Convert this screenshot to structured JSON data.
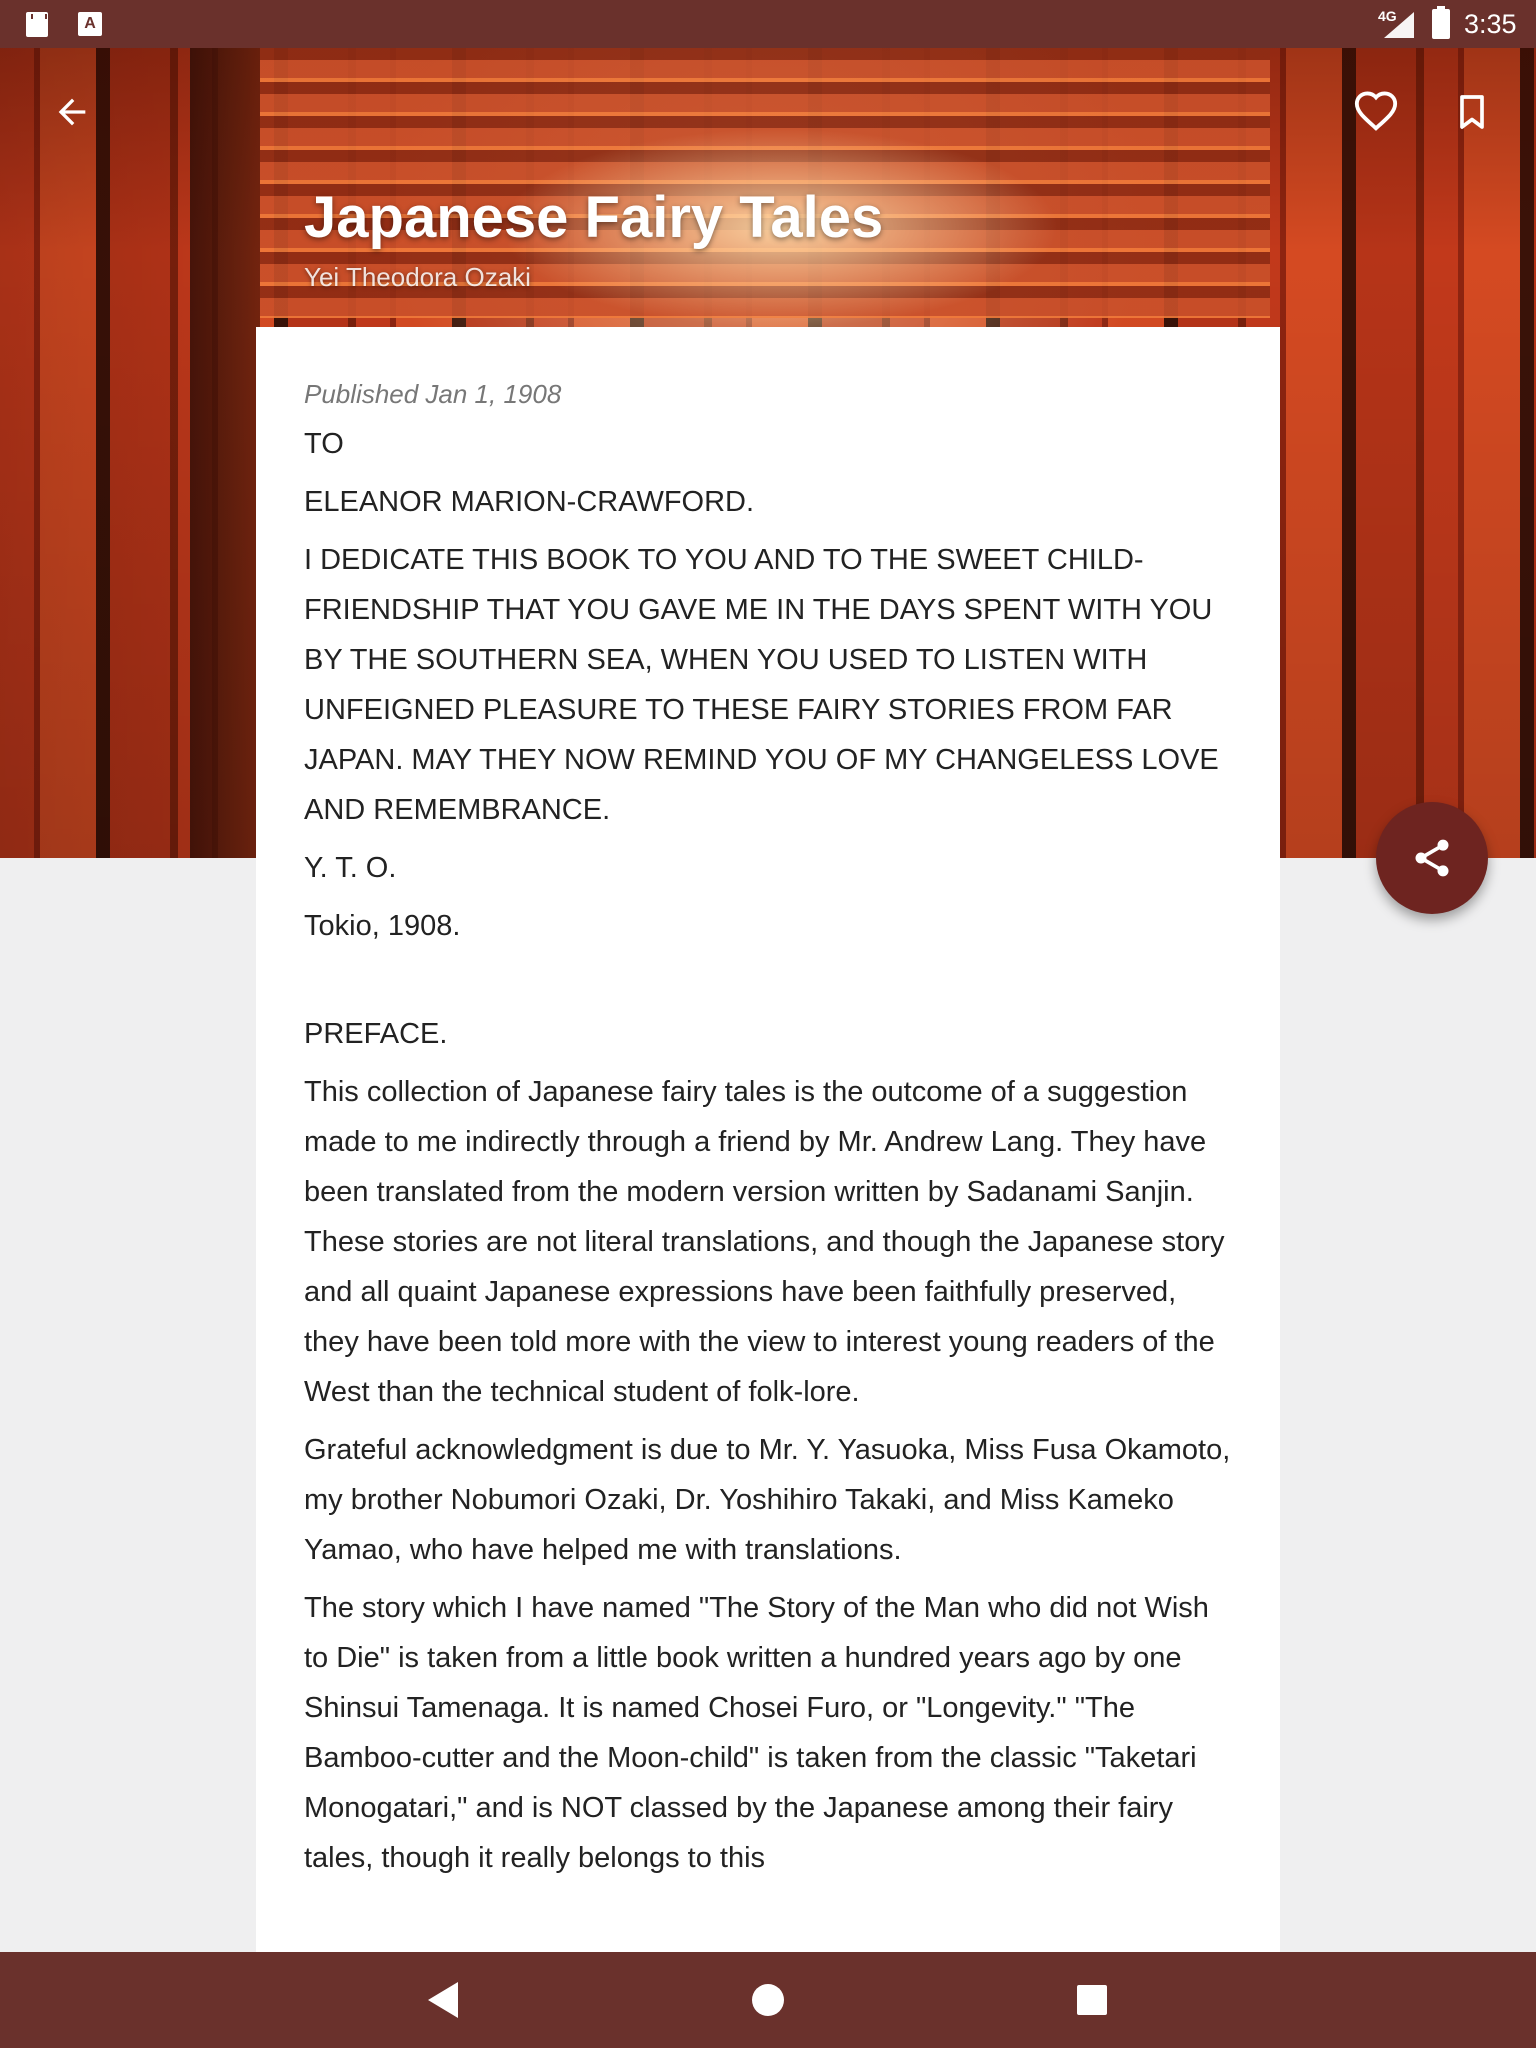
{
  "status_bar": {
    "network": "4G",
    "time": "3:35"
  },
  "header": {
    "title": "Japanese Fairy Tales",
    "author": "Yei Theodora Ozaki"
  },
  "icons": {
    "back": "arrow-back-icon",
    "favorite": "heart-outline-icon",
    "bookmark": "bookmark-outline-icon",
    "share": "share-icon"
  },
  "content": {
    "published": "Published Jan 1, 1908",
    "paragraphs": [
      "TO",
      "ELEANOR MARION-CRAWFORD.",
      "I DEDICATE THIS BOOK TO YOU AND TO THE SWEET CHILD-FRIENDSHIP THAT YOU GAVE ME IN THE DAYS SPENT WITH YOU BY THE SOUTHERN SEA, WHEN YOU USED TO LISTEN WITH UNFEIGNED PLEASURE TO THESE FAIRY STORIES FROM FAR JAPAN. MAY THEY NOW REMIND YOU OF MY CHANGELESS LOVE AND REMEMBRANCE.",
      "Y. T. O.",
      "Tokio, 1908.",
      "PREFACE.",
      "This collection of Japanese fairy tales is the outcome of a suggestion made to me indirectly through a friend by Mr. Andrew Lang. They have been translated from the modern version written by Sadanami Sanjin. These stories are not literal translations, and though the Japanese story and all quaint Japanese expressions have been faithfully preserved, they have been told more with the view to interest young readers of the West than the technical student of folk-lore.",
      "Grateful acknowledgment is due to Mr. Y. Yasuoka, Miss Fusa Okamoto, my brother Nobumori Ozaki, Dr. Yoshihiro Takaki, and Miss Kameko Yamao, who have helped me with translations.",
      "The story which I have named \"The Story of the Man who did not Wish to Die\" is taken from a little book written a hundred years ago by one Shinsui Tamenaga. It is named Chosei Furo, or \"Longevity.\" \"The Bamboo-cutter and the Moon-child\" is taken from the classic \"Taketari Monogatari,\" and is NOT classed by the Japanese among their fairy tales, though it really belongs to this"
    ]
  },
  "nav_bar": {
    "back": "nav-back-icon",
    "home": "nav-home-icon",
    "recents": "nav-recents-icon"
  }
}
